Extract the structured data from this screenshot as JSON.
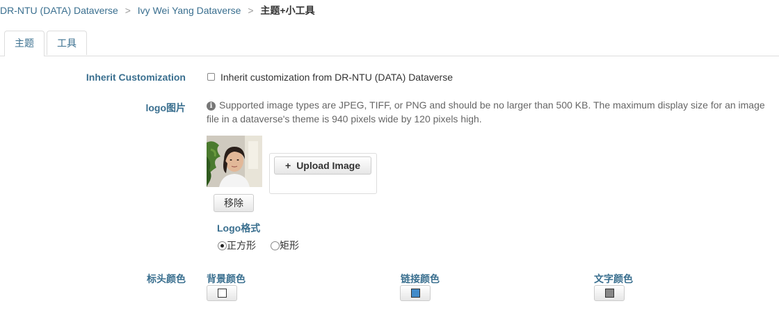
{
  "breadcrumb": {
    "items": [
      "DR-NTU (DATA) Dataverse",
      "Ivy Wei Yang Dataverse"
    ],
    "separator": ">",
    "current": "主题+小工具"
  },
  "tabs": [
    {
      "label": "主题",
      "active": true
    },
    {
      "label": "工具",
      "active": false
    }
  ],
  "inherit": {
    "label": "Inherit Customization",
    "checkbox_label": "Inherit customization from DR-NTU (DATA) Dataverse",
    "checked": false
  },
  "logo": {
    "label": "logo图片",
    "help_line1": "Supported image types are JPEG, TIFF, or PNG and should be no larger than 500 KB. The maximum display size for an image",
    "help_line2": "file in a dataverse's theme is 940 pixels wide by 120 pixels high.",
    "upload_label": "Upload Image",
    "remove_label": "移除",
    "format_label": "Logo格式",
    "format_options": [
      {
        "label": "正方形",
        "selected": true
      },
      {
        "label": "矩形",
        "selected": false
      }
    ]
  },
  "header_colors": {
    "label": "标头颜色",
    "background": {
      "label": "背景颜色",
      "color": "#ffffff"
    },
    "link": {
      "label": "链接颜色",
      "color": "#428bca"
    },
    "text": {
      "label": "文字颜色",
      "color": "#888888"
    }
  }
}
